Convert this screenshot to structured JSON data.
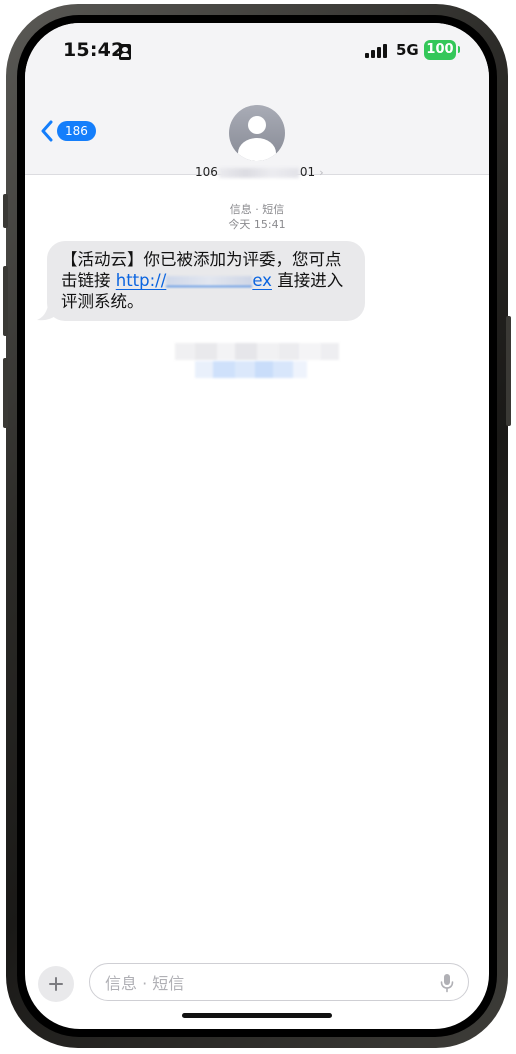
{
  "status_bar": {
    "time": "15:42",
    "network": "5G",
    "battery": "100"
  },
  "header": {
    "back_badge": "186",
    "contact_prefix": "106",
    "contact_suffix": "01"
  },
  "conversation": {
    "service_label": "信息 · 短信",
    "timestamp": "今天 15:41",
    "message": {
      "text_before_link": "【活动云】你已被添加为评委，您可点击链接 ",
      "link_prefix": "http://",
      "link_suffix": "ex",
      "text_after_link": " 直接进入评测系统。"
    }
  },
  "composer": {
    "placeholder": "信息 · 短信"
  },
  "icons": {
    "back": "chevron-left-icon",
    "avatar": "person-icon",
    "add": "plus-icon",
    "mic": "microphone-icon"
  },
  "colors": {
    "accent": "#147efb",
    "link": "#0a64e0",
    "battery": "#34c759",
    "bubble": "#e9e9eb"
  }
}
